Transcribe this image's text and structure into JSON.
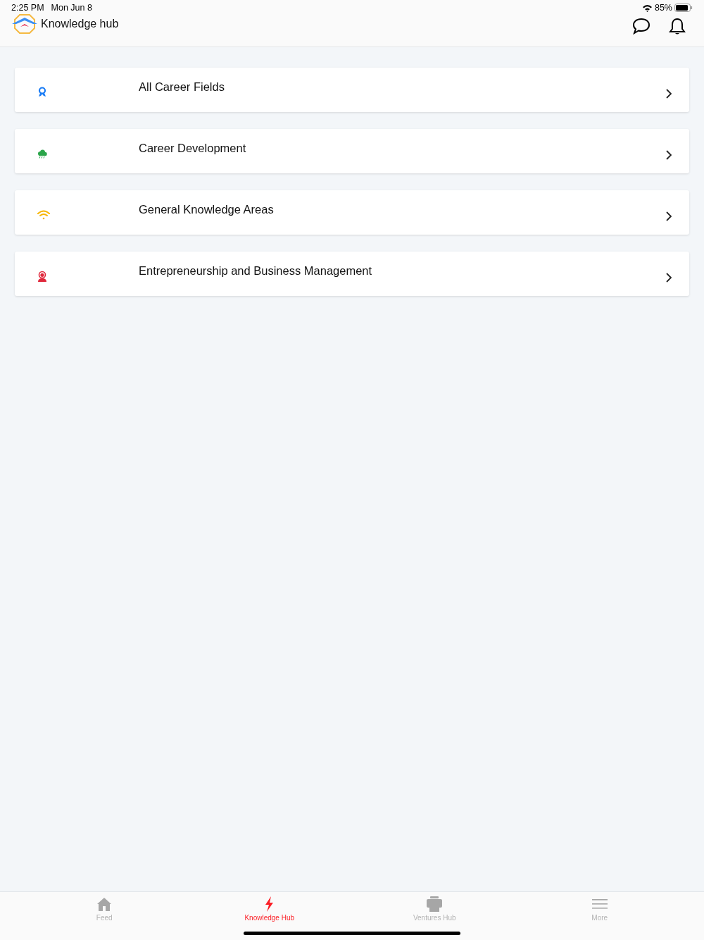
{
  "status_bar": {
    "time": "2:25 PM",
    "date": "Mon Jun 8",
    "battery": "85%"
  },
  "header": {
    "title": "Knowledge hub"
  },
  "categories": [
    {
      "label": "All Career Fields",
      "kind": "award",
      "color": "#1a7cf5"
    },
    {
      "label": "Career Development",
      "kind": "cloud",
      "color": "#2aa54a"
    },
    {
      "label": "General Knowledge Areas",
      "kind": "wifi",
      "color": "#f7b500"
    },
    {
      "label": "Entrepreneurship and Business Management",
      "kind": "agent",
      "color": "#e0283c"
    }
  ],
  "tabs": [
    {
      "label": "Feed",
      "kind": "home",
      "selected": false
    },
    {
      "label": "Knowledge Hub",
      "kind": "bolt",
      "selected": true
    },
    {
      "label": "Ventures Hub",
      "kind": "printer",
      "selected": false
    },
    {
      "label": "More",
      "kind": "menu",
      "selected": false
    }
  ]
}
